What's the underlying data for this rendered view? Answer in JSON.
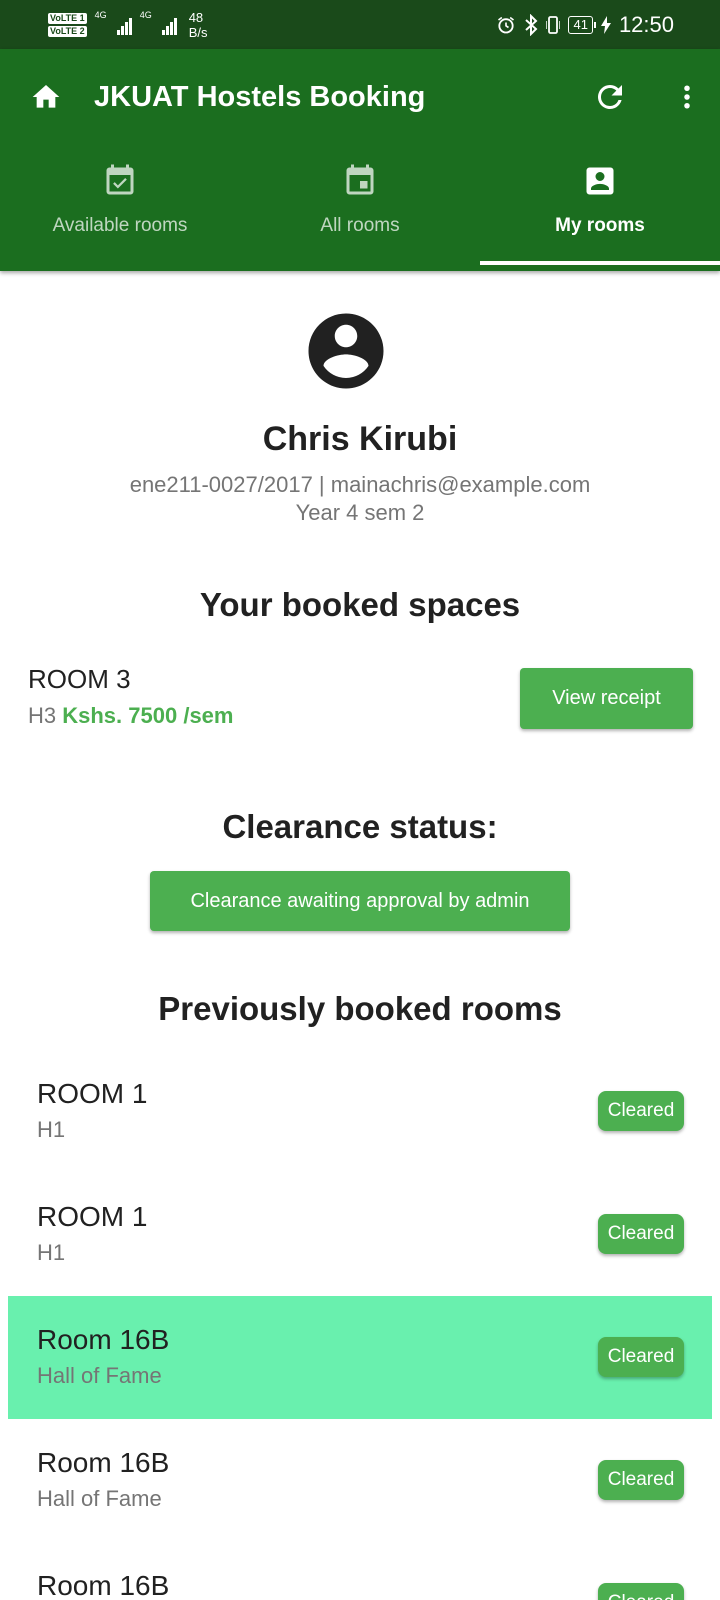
{
  "status_bar": {
    "volte1": "VoLTE 1",
    "volte2": "VoLTE 2",
    "net1": "4G",
    "net2": "4G",
    "speed_value": "48",
    "speed_unit": "B/s",
    "battery": "41",
    "time": "12:50"
  },
  "app_bar": {
    "title": "JKUAT Hostels Booking",
    "icons": {
      "home": "home-icon",
      "refresh": "refresh-icon",
      "more": "more-vert-icon"
    }
  },
  "tabs": [
    {
      "label": "Available rooms",
      "icon": "event-available-icon",
      "active": false
    },
    {
      "label": "All rooms",
      "icon": "calendar-icon",
      "active": false
    },
    {
      "label": "My rooms",
      "icon": "account-box-icon",
      "active": true
    }
  ],
  "profile": {
    "name": "Chris Kirubi",
    "id_email": "ene211-0027/2017 | mainachris@example.com",
    "year": "Year 4 sem 2"
  },
  "booked": {
    "heading": "Your booked spaces",
    "room": "ROOM 3",
    "hostel": "H3",
    "price": "Kshs. 7500 /sem",
    "button": "View receipt"
  },
  "clearance": {
    "heading": "Clearance status:",
    "status": "Clearance awaiting approval by admin"
  },
  "previous": {
    "heading": "Previously booked rooms",
    "items": [
      {
        "room": "ROOM 1",
        "hostel": "H1",
        "status": "Cleared"
      },
      {
        "room": "ROOM 1",
        "hostel": "H1",
        "status": "Cleared"
      },
      {
        "room": "Room 16B",
        "hostel": "Hall of Fame",
        "status": "Cleared"
      },
      {
        "room": "Room 16B",
        "hostel": "Hall of Fame",
        "status": "Cleared"
      },
      {
        "room": "Room 16B",
        "hostel": "",
        "status": "Cleared"
      }
    ]
  },
  "colors": {
    "status_bar": "#1a4a1a",
    "app_bar": "#1b6e1f",
    "accent": "#4caf50",
    "highlight": "#69f0ae"
  }
}
